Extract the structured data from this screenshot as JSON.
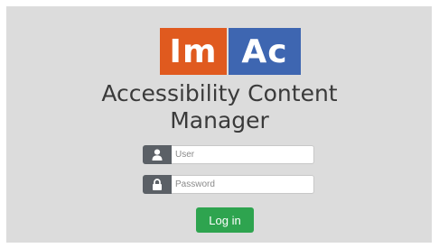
{
  "logo": {
    "left_text": "Im",
    "right_text": "Ac",
    "left_color": "#e05a1f",
    "right_color": "#3e66b1"
  },
  "title_line1": "Accessibility Content",
  "title_line2": "Manager",
  "form": {
    "user": {
      "placeholder": "User",
      "value": "",
      "icon": "user-icon"
    },
    "password": {
      "placeholder": "Password",
      "value": "",
      "icon": "lock-icon"
    },
    "login_label": "Log in"
  },
  "colors": {
    "addon": "#5b6066",
    "button": "#2ea44f",
    "background": "#dcdcdc"
  }
}
